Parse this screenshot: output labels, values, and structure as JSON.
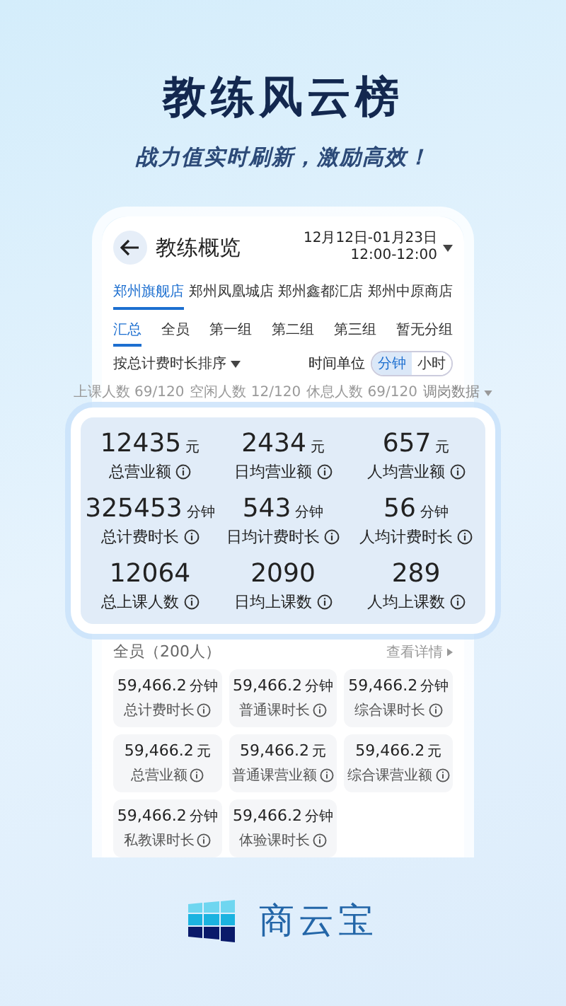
{
  "headline": "教练风云榜",
  "tagline": "战力值实时刷新，激励高效！",
  "screen": {
    "title": "教练概览",
    "date_range": "12月12日-01月23日",
    "time_range": "12:00-12:00",
    "stores": [
      {
        "label": "郑州旗舰店",
        "selected": true
      },
      {
        "label": "郑州凤凰城店",
        "selected": false
      },
      {
        "label": "郑州鑫都汇店",
        "selected": false
      },
      {
        "label": "郑州中原商店",
        "selected": false
      }
    ],
    "groups": [
      {
        "label": "汇总",
        "selected": true
      },
      {
        "label": "全员",
        "selected": false
      },
      {
        "label": "第一组",
        "selected": false
      },
      {
        "label": "第二组",
        "selected": false
      },
      {
        "label": "第三组",
        "selected": false
      },
      {
        "label": "暂无分组",
        "selected": false
      }
    ],
    "sort": "按总计费时长排序",
    "time_unit_label": "时间单位",
    "time_units": [
      {
        "label": "分钟",
        "selected": true
      },
      {
        "label": "小时",
        "selected": false
      }
    ],
    "summary": [
      "上课人数 69/120",
      "空闲人数 12/120",
      "休息人数 69/120"
    ],
    "summary_link": "调岗数据",
    "stats": [
      {
        "value": "12435",
        "unit": "元",
        "label": "总营业额"
      },
      {
        "value": "2434",
        "unit": "元",
        "label": "日均营业额"
      },
      {
        "value": "657",
        "unit": "元",
        "label": "人均营业额"
      },
      {
        "value": "325453",
        "unit": "分钟",
        "label": "总计费时长"
      },
      {
        "value": "543",
        "unit": "分钟",
        "label": "日均计费时长"
      },
      {
        "value": "56",
        "unit": "分钟",
        "label": "人均计费时长"
      },
      {
        "value": "12064",
        "label": "总上课人数"
      },
      {
        "value": "2090",
        "label": "日均上课数"
      },
      {
        "value": "289",
        "label": "人均上课数"
      }
    ],
    "section_title": "全员（200人）",
    "section_link": "查看详情",
    "cards": [
      {
        "value": "59,466.2",
        "unit": "分钟",
        "label": "总计费时长"
      },
      {
        "value": "59,466.2",
        "unit": "分钟",
        "label": "普通课时长"
      },
      {
        "value": "59,466.2",
        "unit": "分钟",
        "label": "综合课时长"
      },
      {
        "value": "59,466.2",
        "unit": "元",
        "label": "总营业额"
      },
      {
        "value": "59,466.2",
        "unit": "元",
        "label": "普通课营业额"
      },
      {
        "value": "59,466.2",
        "unit": "元",
        "label": "综合课营业额"
      },
      {
        "value": "59,466.2",
        "unit": "分钟",
        "label": "私教课时长"
      },
      {
        "value": "59,466.2",
        "unit": "分钟",
        "label": "体验课时长"
      }
    ]
  },
  "brand": "商云宝"
}
